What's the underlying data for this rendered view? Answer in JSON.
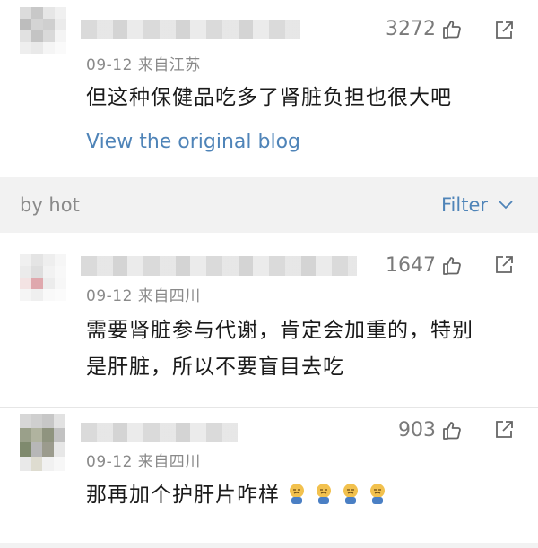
{
  "comments": [
    {
      "likes": "3272",
      "meta": "09-12  来自江苏",
      "text": "但这种保健品吃多了肾脏负担也很大吧",
      "link": "View the original blog"
    },
    {
      "likes": "1647",
      "meta": "09-12  来自四川",
      "text_line1": "需要肾脏参与代谢，肯定会加重的，特别",
      "text_line2": "是肝脏，所以不要盲目去吃"
    },
    {
      "likes": "903",
      "meta": "09-12  来自四川",
      "text": "那再加个护肝片咋样"
    }
  ],
  "filter_bar": {
    "sort_label": "by hot",
    "filter_label": "Filter"
  },
  "colors": {
    "link": "#4f84b8",
    "meta": "#8a8a8a",
    "background": "#f2f2f2"
  },
  "icons": [
    "thumbs-up-icon",
    "share-icon",
    "chevron-down-icon",
    "emoji-icon"
  ]
}
